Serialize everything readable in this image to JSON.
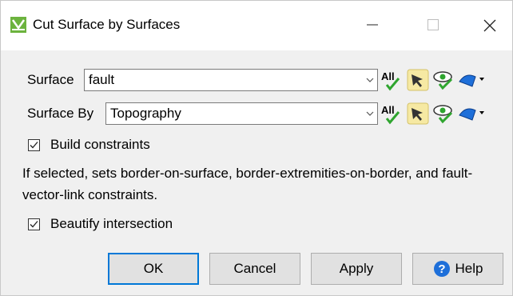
{
  "window": {
    "title": "Cut Surface by Surfaces"
  },
  "surface_row": {
    "label": "Surface",
    "value": "fault",
    "all_label": "All"
  },
  "surface_by_row": {
    "label": "Surface By",
    "value": "Topography",
    "all_label": "All"
  },
  "build_constraints": {
    "label": "Build constraints",
    "checked": true
  },
  "info_text": "If selected, sets border-on-surface, border-extremities-on-border, and fault-vector-link constraints.",
  "beautify": {
    "label": "Beautify intersection",
    "checked": true
  },
  "buttons": {
    "ok": "OK",
    "cancel": "Cancel",
    "apply": "Apply",
    "help": "Help"
  },
  "colors": {
    "accent": "#0078d7",
    "check_green": "#2fa52f",
    "help_blue": "#1e6fd9",
    "app_icon_green": "#6cb33e"
  },
  "icons": [
    "app-icon",
    "minimize-icon",
    "maximize-icon",
    "close-icon",
    "all-select-icon",
    "pick-arrow-icon",
    "visibility-eye-icon",
    "surface-style-icon",
    "chevron-down-icon",
    "checkmark-icon",
    "help-icon"
  ]
}
